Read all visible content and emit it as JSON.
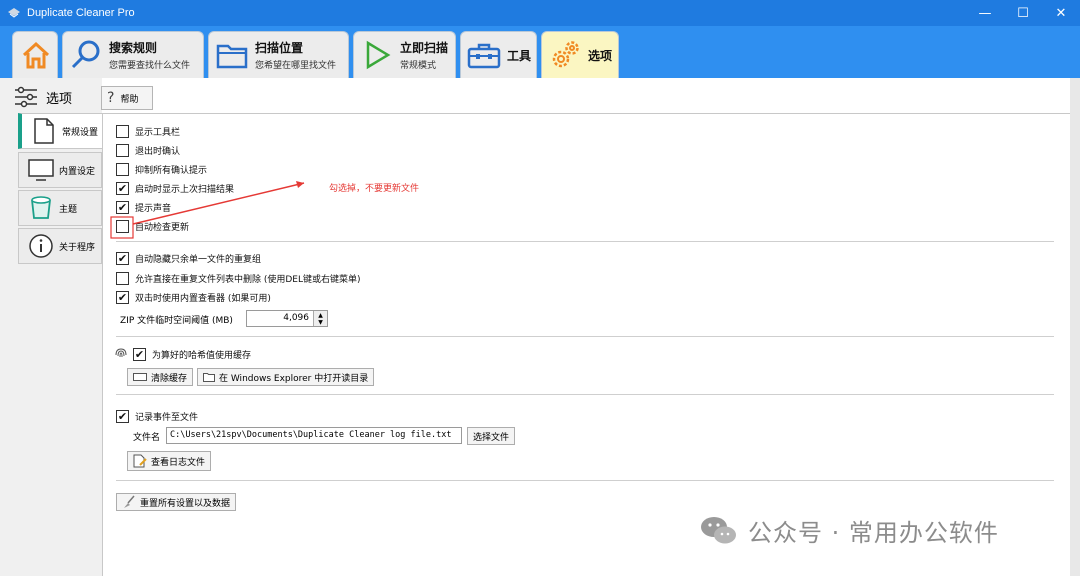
{
  "window": {
    "title": "Duplicate Cleaner Pro",
    "controls": {
      "minimize": "—",
      "maximize": "☐",
      "close": "✕"
    }
  },
  "ribbon": {
    "tabs": [
      {
        "id": "home",
        "icon": "home-icon",
        "big": "",
        "small": ""
      },
      {
        "id": "search-rules",
        "icon": "search-icon",
        "big": "搜索规则",
        "small": "您需要查找什么文件"
      },
      {
        "id": "scan-location",
        "icon": "folder-icon",
        "big": "扫描位置",
        "small": "您希望在哪里找文件"
      },
      {
        "id": "scan-now",
        "icon": "play-icon",
        "big": "立即扫描",
        "small": "常规模式"
      },
      {
        "id": "tools",
        "icon": "toolbox-icon",
        "big": "工具",
        "small": ""
      },
      {
        "id": "options",
        "icon": "gears-icon",
        "big": "选项",
        "small": "",
        "active": true
      }
    ]
  },
  "options_header": {
    "label": "选项",
    "help_label": "帮助"
  },
  "sidebar": {
    "items": [
      {
        "label": "常规设置",
        "icon": "document-icon",
        "active": true
      },
      {
        "label": "内置设定",
        "icon": "monitor-icon"
      },
      {
        "label": "主题",
        "icon": "paint-bucket-icon"
      },
      {
        "label": "关于程序",
        "icon": "info-icon"
      }
    ]
  },
  "general": {
    "group1": [
      {
        "label": "显示工具栏",
        "checked": false
      },
      {
        "label": "退出时确认",
        "checked": false
      },
      {
        "label": "抑制所有确认提示",
        "checked": false
      },
      {
        "label": "启动时显示上次扫描结果",
        "checked": true
      },
      {
        "label": "提示声音",
        "checked": true
      },
      {
        "label": "自动检查更新",
        "checked": false
      }
    ],
    "group2": [
      {
        "label": "自动隐藏只余单一文件的重复组",
        "checked": true
      },
      {
        "label": "允许直接在重复文件列表中删除 (使用DEL键或右键菜单)",
        "checked": false
      },
      {
        "label": "双击时使用内置查看器 (如果可用)",
        "checked": true
      }
    ],
    "zip_label": "ZIP 文件临时空间阈值 (MB)",
    "zip_value": "4,096",
    "hash_cache": {
      "label": "为算好的哈希值使用缓存",
      "checked": true
    },
    "clear_cache_label": "清除缓存",
    "open_explorer_label": "在 Windows Explorer 中打开读目录",
    "log": {
      "label": "记录事件至文件",
      "checked": true
    },
    "filename_label": "文件名",
    "filename_value": "C:\\Users\\21spv\\Documents\\Duplicate Cleaner log file.txt",
    "choose_file_label": "选择文件",
    "view_log_label": "查看日志文件",
    "reset_label": "重置所有设置以及数据"
  },
  "annotation": {
    "text": "勾选掉，不要更新文件",
    "color": "#e53935"
  },
  "watermark": {
    "text": "公众号 · 常用办公软件"
  },
  "colors": {
    "titlebar": "#1f7be0",
    "ribbon": "#2f8ff0",
    "active_tab": "#fbf6c2",
    "accent": "#1aa08a"
  }
}
